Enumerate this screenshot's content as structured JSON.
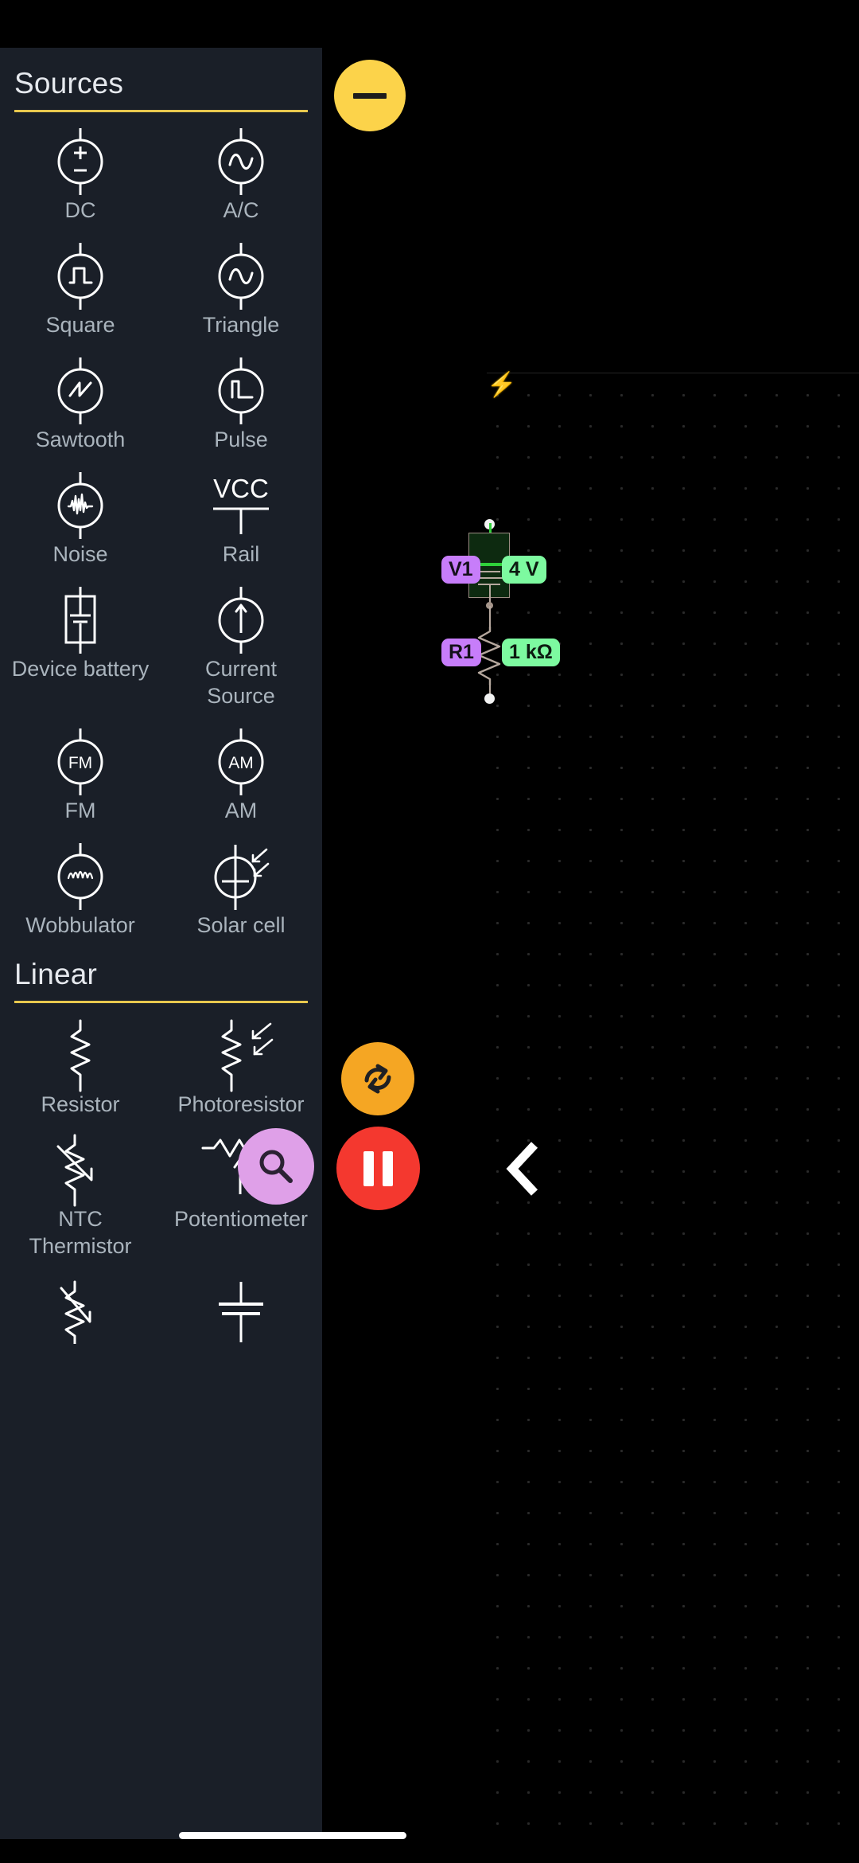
{
  "app": {
    "canvas_bg": "#000000",
    "panel_bg": "#1a1f28",
    "accent_rule": "#e8c84e",
    "label_color": "#aab4bd"
  },
  "panel": {
    "sections": [
      {
        "title": "Sources",
        "items": [
          {
            "label": "DC",
            "icon": "dc-source-icon"
          },
          {
            "label": "A/C",
            "icon": "ac-source-icon"
          },
          {
            "label": "Square",
            "icon": "square-wave-source-icon"
          },
          {
            "label": "Triangle",
            "icon": "triangle-wave-source-icon"
          },
          {
            "label": "Sawtooth",
            "icon": "sawtooth-wave-source-icon"
          },
          {
            "label": "Pulse",
            "icon": "pulse-source-icon"
          },
          {
            "label": "Noise",
            "icon": "noise-source-icon"
          },
          {
            "label": "Rail",
            "icon": "vcc-rail-icon"
          },
          {
            "label": "Device battery",
            "icon": "device-battery-icon"
          },
          {
            "label": "Current Source",
            "icon": "current-source-icon"
          },
          {
            "label": "FM",
            "icon": "fm-source-icon"
          },
          {
            "label": "AM",
            "icon": "am-source-icon"
          },
          {
            "label": "Wobbulator",
            "icon": "wobbulator-icon"
          },
          {
            "label": "Solar cell",
            "icon": "solar-cell-icon"
          }
        ]
      },
      {
        "title": "Linear",
        "items": [
          {
            "label": "Resistor",
            "icon": "resistor-icon"
          },
          {
            "label": "Photoresistor",
            "icon": "photoresistor-icon"
          },
          {
            "label": "NTC Thermistor",
            "icon": "ntc-thermistor-icon"
          },
          {
            "label": "Potentiometer",
            "icon": "potentiometer-icon"
          },
          {
            "label": "",
            "icon": "ptc-thermistor-icon"
          },
          {
            "label": "",
            "icon": "capacitor-icon"
          }
        ]
      }
    ],
    "rail_text": "VCC",
    "fm_text": "FM",
    "am_text": "AM"
  },
  "circuit": {
    "components": [
      {
        "ref": "V1",
        "value": "4 V",
        "type": "battery",
        "selected": true
      },
      {
        "ref": "R1",
        "value": "1 kΩ",
        "type": "resistor",
        "selected": false
      }
    ],
    "ref_tag_color": "#c77dfa",
    "value_tag_color": "#7dfaa0",
    "wire_color": "#b6a89e",
    "selection_fill": "#0d2a10"
  },
  "controls": {
    "zoom_out_label": "−",
    "zoom_out_color": "#fcd34a",
    "refresh_label": "reset-simulation",
    "refresh_color": "#f5a623",
    "pause_label": "pause-simulation",
    "pause_color": "#f4382f",
    "search_label": "search-components",
    "search_color": "#dfa0e8",
    "back_label": "back"
  }
}
